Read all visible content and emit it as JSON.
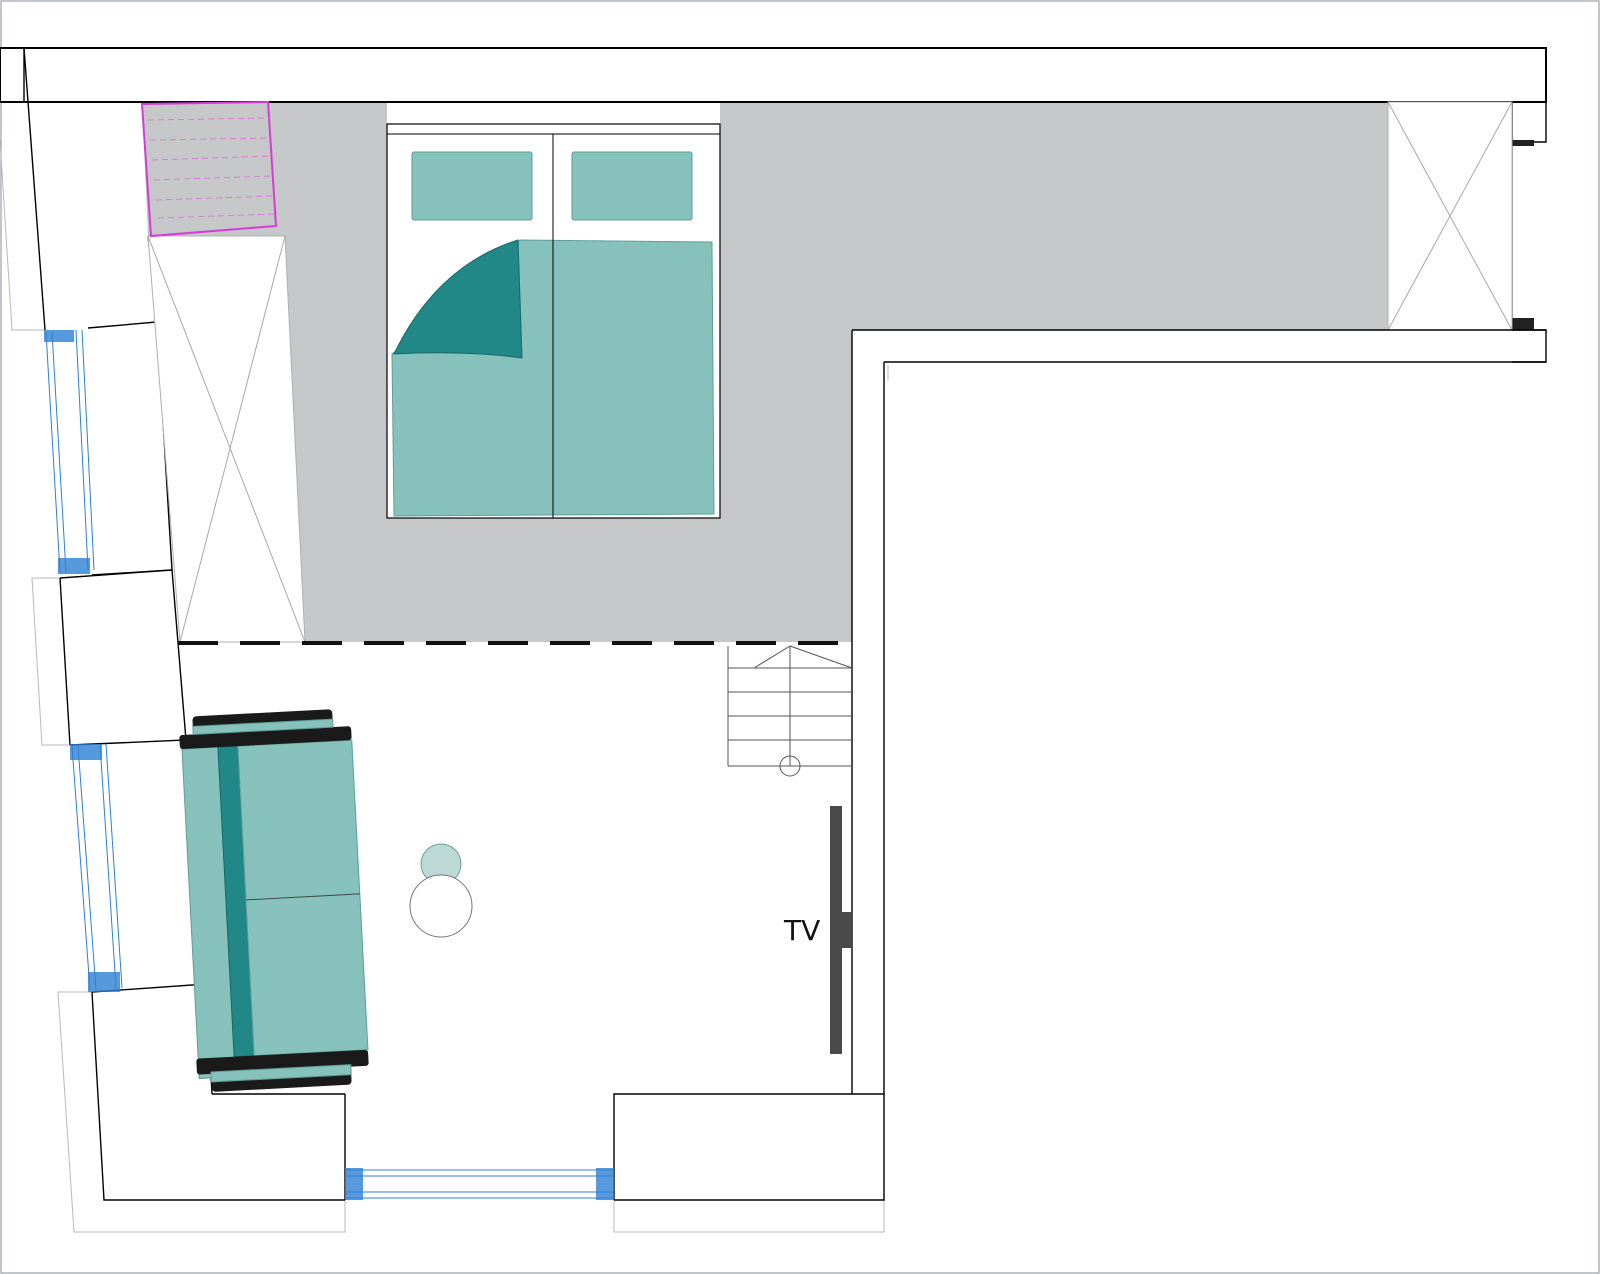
{
  "plan": {
    "labels": {
      "tv": "TV"
    },
    "colors": {
      "floor_grey": "#c6c7c9",
      "teal_light": "#86c1bb",
      "teal_dark": "#228787",
      "window_blue": "#2d7fd4",
      "shelf_magenta": "#d63bd8",
      "wall": "#000000"
    }
  }
}
